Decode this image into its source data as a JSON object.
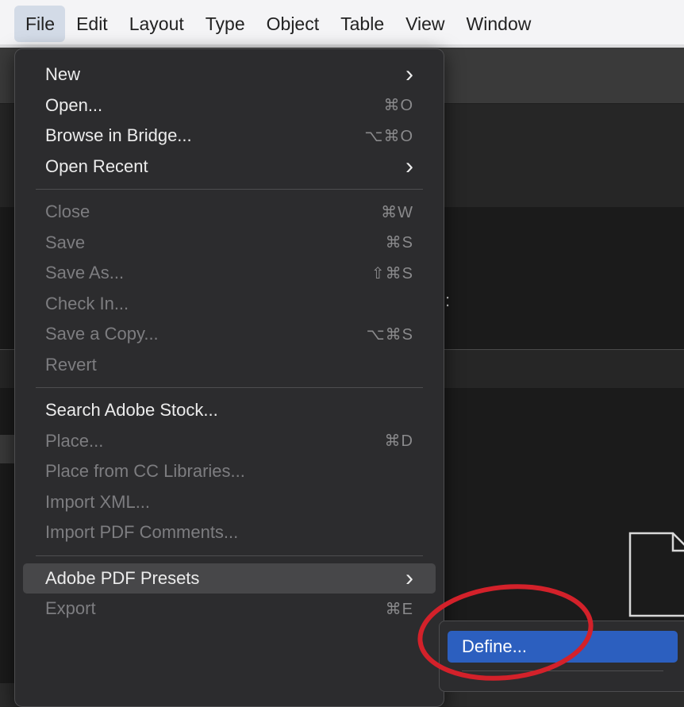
{
  "menubar": {
    "items": [
      {
        "label": "File",
        "active": true
      },
      {
        "label": "Edit"
      },
      {
        "label": "Layout"
      },
      {
        "label": "Type"
      },
      {
        "label": "Object"
      },
      {
        "label": "Table"
      },
      {
        "label": "View"
      },
      {
        "label": "Window"
      }
    ]
  },
  "file_menu": {
    "items": [
      {
        "label": "New",
        "shortcut": "",
        "submenu": true,
        "enabled": true
      },
      {
        "label": "Open...",
        "shortcut": "⌘O",
        "enabled": true
      },
      {
        "label": "Browse in Bridge...",
        "shortcut": "⌥⌘O",
        "enabled": true
      },
      {
        "label": "Open Recent",
        "shortcut": "",
        "submenu": true,
        "enabled": true
      },
      {
        "separator": true
      },
      {
        "label": "Close",
        "shortcut": "⌘W",
        "enabled": false
      },
      {
        "label": "Save",
        "shortcut": "⌘S",
        "enabled": false
      },
      {
        "label": "Save As...",
        "shortcut": "⇧⌘S",
        "enabled": false
      },
      {
        "label": "Check In...",
        "shortcut": "",
        "enabled": false
      },
      {
        "label": "Save a Copy...",
        "shortcut": "⌥⌘S",
        "enabled": false
      },
      {
        "label": "Revert",
        "shortcut": "",
        "enabled": false
      },
      {
        "separator": true
      },
      {
        "label": "Search Adobe Stock...",
        "shortcut": "",
        "enabled": true
      },
      {
        "label": "Place...",
        "shortcut": "⌘D",
        "enabled": false
      },
      {
        "label": "Place from CC Libraries...",
        "shortcut": "",
        "enabled": false
      },
      {
        "label": "Import XML...",
        "shortcut": "",
        "enabled": false
      },
      {
        "label": "Import PDF Comments...",
        "shortcut": "",
        "enabled": false
      },
      {
        "separator": true
      },
      {
        "label": "Adobe PDF Presets",
        "shortcut": "",
        "submenu": true,
        "enabled": true,
        "highlighted": true
      },
      {
        "label": "Export",
        "shortcut": "⌘E",
        "enabled": false
      }
    ]
  },
  "submenu": {
    "items": [
      {
        "label": "Define...",
        "selected": true
      }
    ]
  },
  "colors": {
    "menubar_bg": "#f4f4f6",
    "menu_bg": "#2c2c2e",
    "selection_blue": "#2c5fbf",
    "annotation_red": "#d3212a"
  },
  "icons": {
    "submenu_arrow": "chevron-right-icon",
    "document": "document-icon"
  }
}
